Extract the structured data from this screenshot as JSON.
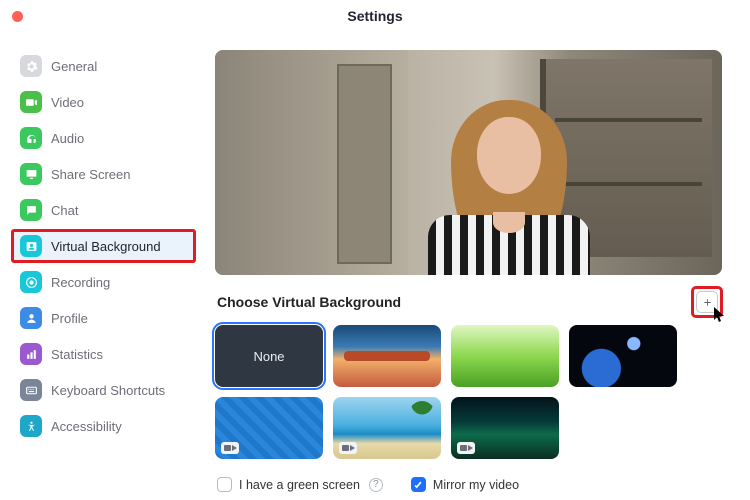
{
  "window": {
    "title": "Settings"
  },
  "sidebar": {
    "items": [
      {
        "label": "General"
      },
      {
        "label": "Video"
      },
      {
        "label": "Audio"
      },
      {
        "label": "Share Screen"
      },
      {
        "label": "Chat"
      },
      {
        "label": "Virtual Background"
      },
      {
        "label": "Recording"
      },
      {
        "label": "Profile"
      },
      {
        "label": "Statistics"
      },
      {
        "label": "Keyboard Shortcuts"
      },
      {
        "label": "Accessibility"
      }
    ]
  },
  "main": {
    "section_title": "Choose Virtual Background",
    "none_label": "None",
    "green_screen_label": "I have a green screen",
    "mirror_label": "Mirror my video"
  }
}
